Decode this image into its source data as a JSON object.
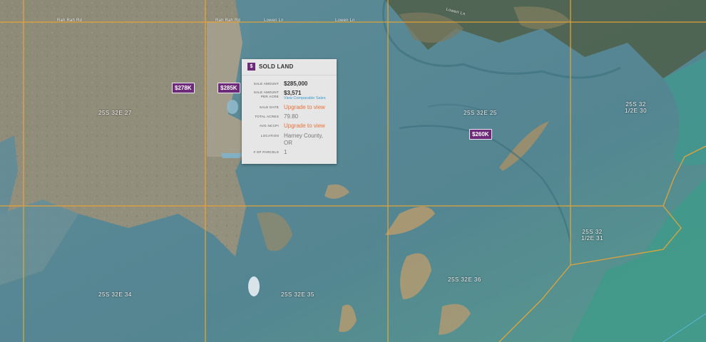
{
  "road_labels": {
    "r1": "Rah Rah Rd",
    "r2": "Rah Rah Rd",
    "r3": "Lowen Ln",
    "r4": "Lowen Ln",
    "r5": "Lowen Ln"
  },
  "sections": {
    "s27": "25S 32E 27",
    "s25": "25S 32E 25",
    "s30_a": "25S 32",
    "s30_b": "1/2E 30",
    "s31_a": "25S 32",
    "s31_b": "1/2E 31",
    "s34": "25S 32E 34",
    "s35": "25S 32E 35",
    "s36": "25S 32E 36"
  },
  "markers": {
    "m278": "$278K",
    "m285": "$285K",
    "m260": "$260K"
  },
  "popup": {
    "icon": "$",
    "title": "SOLD LAND",
    "sale_amount_label": "SALE AMOUNT",
    "sale_amount": "$285,000",
    "per_acre_label_1": "SALE AMOUNT",
    "per_acre_label_2": "PER ACRE",
    "per_acre": "$3,571",
    "comparable_link": "View Comparable Sales",
    "sale_date_label": "SALE DATE",
    "sale_date": "Upgrade to view",
    "total_acres_label": "TOTAL ACRES",
    "total_acres": "79.80",
    "nccpi_label": "AVG NCCPI",
    "nccpi": "Upgrade to view",
    "location_label": "LOCATION",
    "location_1": "Harney County,",
    "location_2": "OR",
    "parcels_label": "# OF PARCELS",
    "parcels": "1"
  },
  "colors": {
    "marker": "#6d2a78",
    "grid_line": "#e8a534",
    "link_orange": "#e8733a",
    "link_blue": "#3a9ad0"
  }
}
